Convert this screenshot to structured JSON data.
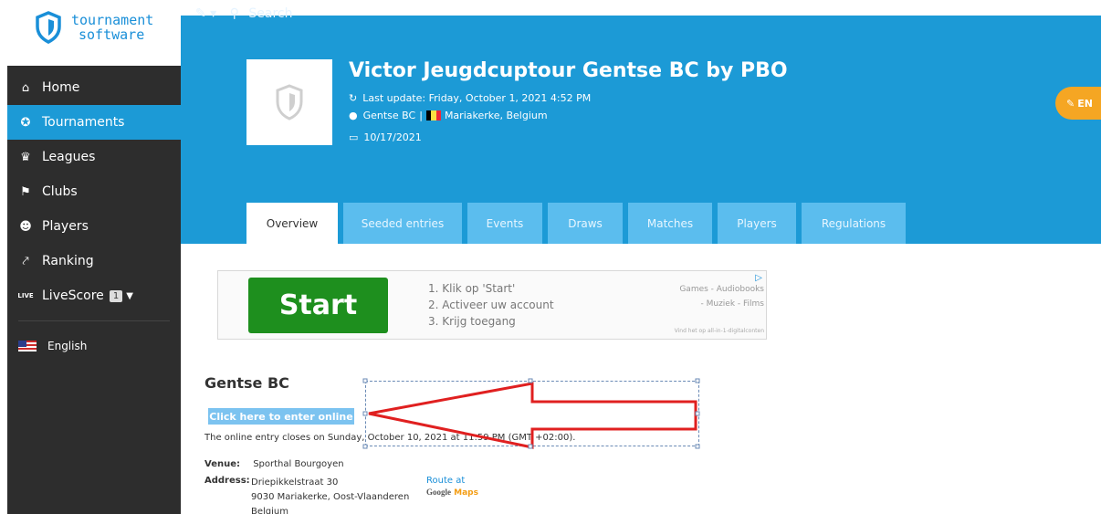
{
  "logo": {
    "line1": "tournament",
    "line2": "software",
    "brand_color": "#1a8fd8"
  },
  "sidebar": {
    "items": [
      {
        "label": "Home",
        "icon": "home-icon",
        "glyph": "⌂"
      },
      {
        "label": "Tournaments",
        "icon": "medal-icon",
        "glyph": "✪",
        "active": true
      },
      {
        "label": "Leagues",
        "icon": "trophy-icon",
        "glyph": "♛"
      },
      {
        "label": "Clubs",
        "icon": "flag-icon",
        "glyph": "⚑"
      },
      {
        "label": "Players",
        "icon": "users-icon",
        "glyph": "☻"
      },
      {
        "label": "Ranking",
        "icon": "chart-line-icon",
        "glyph": "⤤"
      }
    ],
    "livescore": {
      "label": "LiveScore",
      "icon_label": "LIVE",
      "badge": "1"
    },
    "language": "English",
    "bg_color": "#2d2d2d",
    "active_color": "#1c9ad6"
  },
  "topbar": {
    "search_label": "Search"
  },
  "tournament": {
    "title": "Victor Jeugdcuptour Gentse BC by PBO",
    "last_update": "Last update: Friday, October 1, 2021 4:52 PM",
    "club": "Gentse BC",
    "separator": "|",
    "location": "Mariakerke, Belgium",
    "date": "10/17/2021",
    "enter_label": "EN",
    "header_color": "#1c9ad6"
  },
  "tabs": [
    {
      "label": "Overview",
      "active": true
    },
    {
      "label": "Seeded entries"
    },
    {
      "label": "Events"
    },
    {
      "label": "Draws"
    },
    {
      "label": "Matches"
    },
    {
      "label": "Players"
    },
    {
      "label": "Regulations"
    }
  ],
  "ad": {
    "start_label": "Start",
    "steps": [
      "1. Klik op 'Start'",
      "2. Activeer uw account",
      "3. Krijg toegang"
    ],
    "right_line1": "Games - Audiobooks",
    "right_line2": "- Muziek - Films",
    "small_text": "Vind het op all-in-1-digitalconten"
  },
  "content": {
    "club_title": "Gentse BC",
    "enter_online": "Click here to enter online",
    "closes_text": "The online entry closes on Sunday, October 10, 2021 at 11:59 PM (GMT +02:00).",
    "venue_label": "Venue:",
    "venue": "Sporthal Bourgoyen",
    "address_label": "Address:",
    "address_lines": [
      "Driepikkelstraat 30",
      "9030 Mariakerke, Oost-Vlaanderen",
      "Belgium"
    ],
    "route_label": "Route at",
    "google": "Google",
    "maps": "Maps"
  },
  "annotation": {
    "arrow_color": "#e02020"
  }
}
